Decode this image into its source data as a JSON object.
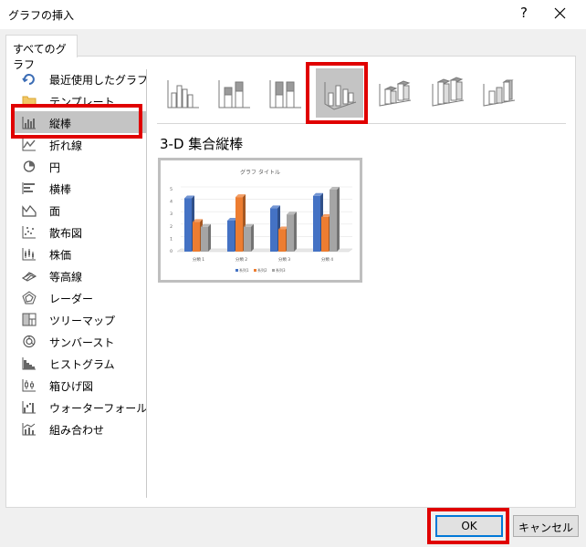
{
  "window": {
    "title": "グラフの挿入",
    "help_icon": "?",
    "close_icon": "close-icon"
  },
  "tabs": [
    {
      "label": "すべてのグラフ",
      "selected": true
    }
  ],
  "categories": [
    {
      "label": "最近使用したグラフ",
      "icon": "recent-icon"
    },
    {
      "label": "テンプレート",
      "icon": "folder-icon"
    },
    {
      "label": "縦棒",
      "icon": "column-chart-icon",
      "selected": true
    },
    {
      "label": "折れ線",
      "icon": "line-chart-icon"
    },
    {
      "label": "円",
      "icon": "pie-chart-icon"
    },
    {
      "label": "横棒",
      "icon": "bar-chart-icon"
    },
    {
      "label": "面",
      "icon": "area-chart-icon"
    },
    {
      "label": "散布図",
      "icon": "scatter-chart-icon"
    },
    {
      "label": "株価",
      "icon": "stock-chart-icon"
    },
    {
      "label": "等高線",
      "icon": "surface-chart-icon"
    },
    {
      "label": "レーダー",
      "icon": "radar-chart-icon"
    },
    {
      "label": "ツリーマップ",
      "icon": "treemap-icon"
    },
    {
      "label": "サンバースト",
      "icon": "sunburst-icon"
    },
    {
      "label": "ヒストグラム",
      "icon": "histogram-icon"
    },
    {
      "label": "箱ひげ図",
      "icon": "box-whisker-icon"
    },
    {
      "label": "ウォーターフォール",
      "icon": "waterfall-icon"
    },
    {
      "label": "組み合わせ",
      "icon": "combo-chart-icon"
    }
  ],
  "subtypes_selected_index": 3,
  "selected_chart": {
    "name": "3-D 集合縦棒",
    "preview": {
      "title": "グラフ タイトル",
      "categories": [
        "分類 1",
        "分類 2",
        "分類 3",
        "分類 4"
      ],
      "y_ticks": [
        "0",
        "1",
        "2",
        "3",
        "4",
        "5"
      ],
      "series": [
        {
          "name": "系列1",
          "color": "#4472c4",
          "values": [
            4.3,
            2.5,
            3.5,
            4.5
          ]
        },
        {
          "name": "系列2",
          "color": "#ed7d31",
          "values": [
            2.4,
            4.4,
            1.8,
            2.8
          ]
        },
        {
          "name": "系列3",
          "color": "#a5a5a5",
          "values": [
            2.0,
            2.0,
            3.0,
            5.0
          ]
        }
      ]
    }
  },
  "buttons": {
    "ok": "OK",
    "cancel": "キャンセル"
  },
  "highlight_color": "#e00000"
}
